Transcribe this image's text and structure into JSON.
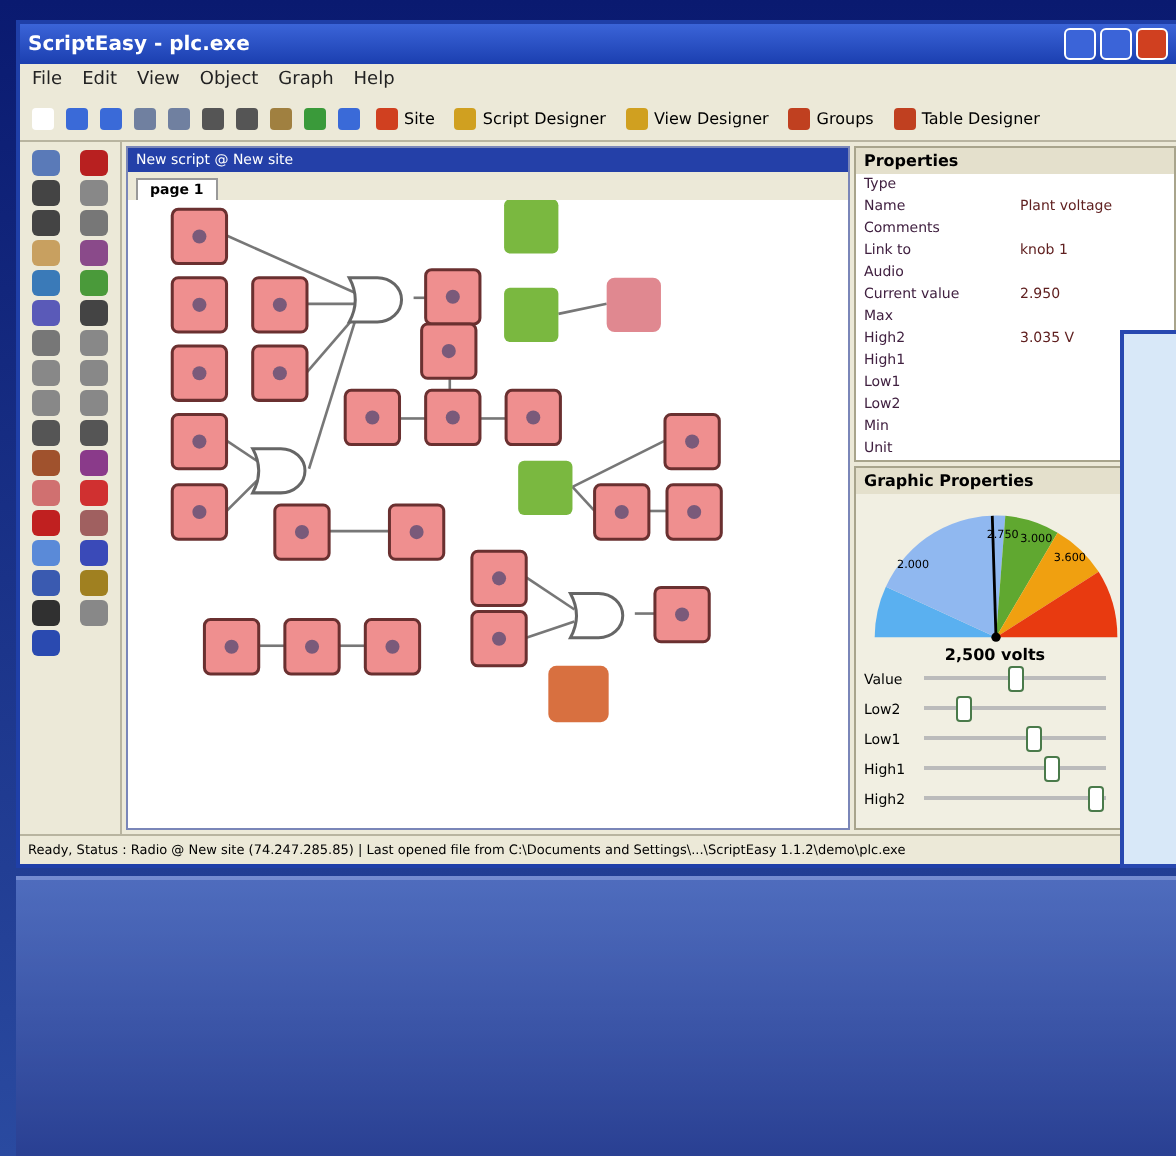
{
  "window": {
    "title": "ScriptEasy - plc.exe"
  },
  "menu": [
    "File",
    "Edit",
    "View",
    "Object",
    "Graph",
    "Help"
  ],
  "toolbar": [
    {
      "label": "Site"
    },
    {
      "label": "Script Designer"
    },
    {
      "label": "View Designer"
    },
    {
      "label": "Groups"
    },
    {
      "label": "Table Designer"
    }
  ],
  "editor": {
    "title": "New script @ New site",
    "tabs": [
      {
        "label": "page 1",
        "selected": true
      }
    ]
  },
  "properties": {
    "title": "Properties",
    "rows": [
      {
        "name": "Type",
        "value": ""
      },
      {
        "name": "Name",
        "value": "Plant voltage"
      },
      {
        "name": "Comments",
        "value": ""
      },
      {
        "name": "Link to",
        "value": "knob 1"
      },
      {
        "name": "Audio",
        "value": ""
      },
      {
        "name": "Current value",
        "value": "2.950"
      },
      {
        "name": "Max",
        "value": ""
      },
      {
        "name": "High2",
        "value": "3.035 V"
      },
      {
        "name": "High1",
        "value": ""
      },
      {
        "name": "Low1",
        "value": ""
      },
      {
        "name": "Low2",
        "value": ""
      },
      {
        "name": "Min",
        "value": ""
      },
      {
        "name": "Unit",
        "value": ""
      }
    ]
  },
  "graphic_properties": {
    "title": "Graphic Properties",
    "gauge_labels": [
      "2.000",
      "2.750",
      "3.000",
      "3.600"
    ],
    "reading": "2,500 volts",
    "sliders": [
      {
        "name": "Value",
        "level": 0.5
      },
      {
        "name": "Low2",
        "level": 0.22
      },
      {
        "name": "Low1",
        "level": 0.6
      },
      {
        "name": "High1",
        "level": 0.7
      },
      {
        "name": "High2",
        "level": 0.95
      }
    ]
  },
  "status_bar": "Ready, Status : Radio @ New site (74.247.285.85) | Last opened file from C:\\Documents and Settings\\...\\ScriptEasy 1.1.2\\demo\\plc.exe"
}
